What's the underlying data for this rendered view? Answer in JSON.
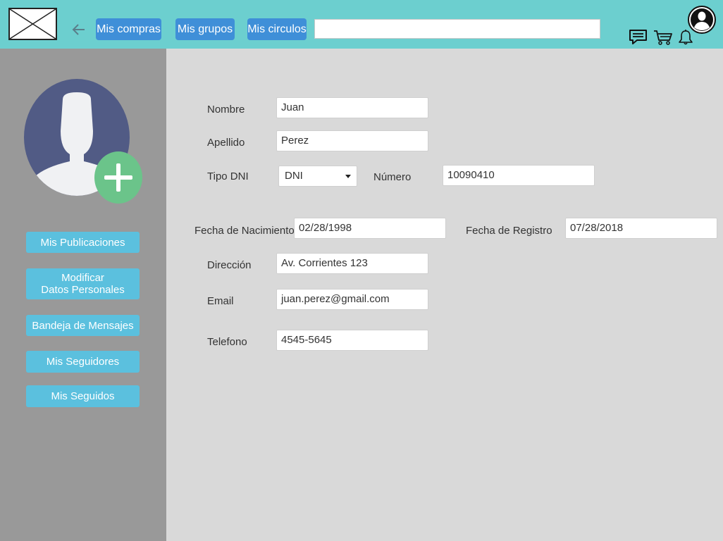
{
  "header": {
    "nav": [
      "Mis compras",
      "Mis grupos",
      "Mis circulos"
    ],
    "search_value": "",
    "icons": [
      "logo-placeholder-icon",
      "back-arrow-icon",
      "chat-icon",
      "cart-icon",
      "bell-icon",
      "user-avatar-icon"
    ]
  },
  "sidebar": {
    "items": [
      "Mis Publicaciones",
      "Modificar\nDatos Personales",
      "Bandeja de Mensajes",
      "Mis Seguidores",
      "Mis Seguidos"
    ]
  },
  "form": {
    "nombre": {
      "label": "Nombre",
      "value": "Juan"
    },
    "apellido": {
      "label": "Apellido",
      "value": "Perez"
    },
    "tipo_dni": {
      "label": "Tipo DNI",
      "value": "DNI"
    },
    "numero": {
      "label": "Número",
      "value": "10090410"
    },
    "fecha_nacimiento": {
      "label": "Fecha de Nacimiento",
      "value": "02/28/1998"
    },
    "fecha_registro": {
      "label": "Fecha de Registro",
      "value": "07/28/2018"
    },
    "direccion": {
      "label": "Dirección",
      "value": "Av. Corrientes 123"
    },
    "email": {
      "label": "Email",
      "value": "juan.perez@gmail.com"
    },
    "telefono": {
      "label": "Telefono",
      "value": "4545-5645"
    }
  },
  "colors": {
    "topbar": "#6ccfcf",
    "nav_button": "#3f8fd8",
    "sidebar": "#999999",
    "sidebar_button": "#5bc0de",
    "content_bg": "#d9d9d9",
    "add_photo": "#6bc48a",
    "avatar_bg": "#515b85"
  }
}
